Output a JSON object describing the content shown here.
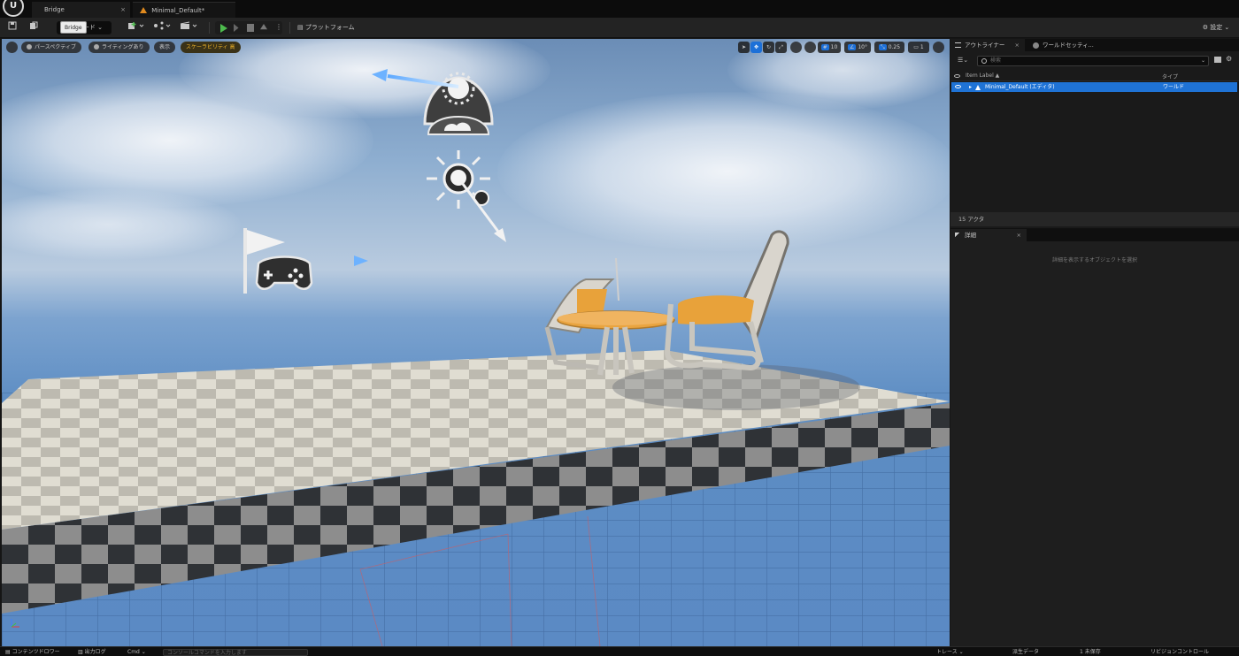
{
  "tabs": {
    "bridge_label": "Bridge",
    "level_label": "Minimal_Default*",
    "close_glyph": "×"
  },
  "toolbar": {
    "tooltip": "Bridge",
    "mode_label": "ード",
    "platform_label": "プラットフォーム",
    "settings_label": "設定"
  },
  "viewport": {
    "perspective": "パースペクティブ",
    "lighting": "ライティングあり",
    "show": "表示",
    "scalability": "スケーラビリティ 高",
    "grid_snap": "10",
    "rotation_snap": "10°",
    "scale_snap": "0.25",
    "camera_speed": "1"
  },
  "outliner": {
    "tab_label": "アウトライナー",
    "world_tab_label": "ワールドセッティ...",
    "search_placeholder": "検索",
    "col_label": "Item Label ▲",
    "col_type": "タイプ",
    "row_label": "Minimal_Default (エディタ)",
    "row_type": "ワールド",
    "actor_count": "15 アクタ"
  },
  "details": {
    "tab_label": "詳細",
    "empty_text": "詳細を表示するオブジェクトを選択"
  },
  "statusbar": {
    "content_drawer": "コンテンツドロワー",
    "output_log": "出力ログ",
    "cmd_label": "Cmd",
    "cmd_placeholder": "コンソールコマンドを入力します",
    "trace": "トレース",
    "derived_data": "派生データ",
    "unsaved": "1 未保存",
    "source_control": "リビジョンコントロール"
  },
  "colors": {
    "accent": "#1f73d6",
    "play_green": "#4dbb4d",
    "scalability_yellow": "#f0b428",
    "chair_orange": "#e8a23a"
  }
}
